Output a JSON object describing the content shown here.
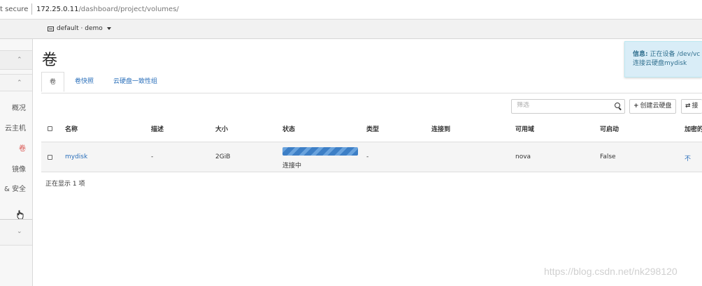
{
  "browser": {
    "secure_label": "t secure",
    "url_host": "172.25.0.11",
    "url_path": "/dashboard/project/volumes/"
  },
  "topbar": {
    "project_label": "default · demo"
  },
  "sidebar": {
    "items": [
      {
        "label": "概况"
      },
      {
        "label": "云主机"
      },
      {
        "label": "卷",
        "active": true
      },
      {
        "label": "镜像"
      },
      {
        "label": "& 安全"
      }
    ]
  },
  "page": {
    "title": "卷"
  },
  "tabs": [
    {
      "label": "卷",
      "active": true
    },
    {
      "label": "卷快照"
    },
    {
      "label": "云硬盘一致性组"
    }
  ],
  "toolbar": {
    "filter_placeholder": "筛选",
    "create_label": "创建云硬盘",
    "accept_label": "接"
  },
  "table": {
    "columns": [
      "名称",
      "描述",
      "大小",
      "状态",
      "类型",
      "连接到",
      "可用域",
      "可启动",
      "加密的"
    ],
    "rows": [
      {
        "name": "mydisk",
        "description": "-",
        "size": "2GiB",
        "status": "连接中",
        "type": "-",
        "attached_to": "",
        "availability_zone": "nova",
        "bootable": "False",
        "encrypted": "不"
      }
    ],
    "footer": "正在显示 1 项"
  },
  "toast": {
    "title": "信息:",
    "line1": "正在设备 /dev/vc",
    "line2": "连接云硬盘mydisk",
    "color": "#d9edf7"
  },
  "watermark": "https://blog.csdn.net/nk298120",
  "colors": {
    "link": "#2a6fba",
    "active_nav": "#d9534f",
    "progress": "#3d7fc6"
  }
}
